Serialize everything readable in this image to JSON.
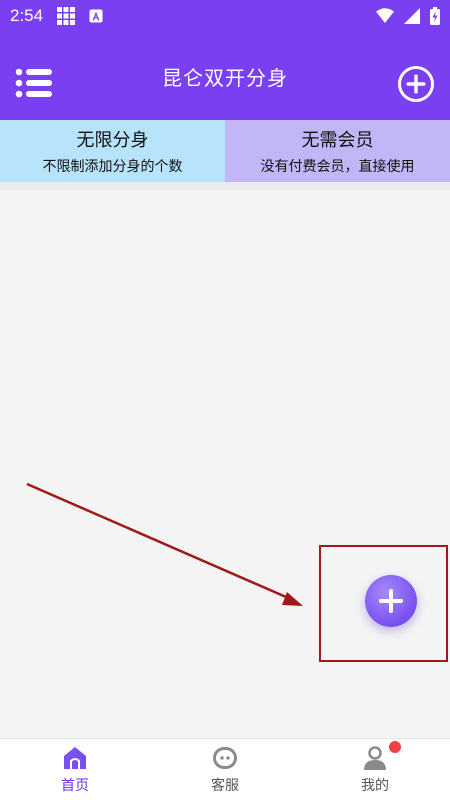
{
  "status_bar": {
    "time": "2:54",
    "icons": [
      "grid-icon",
      "a-badge-icon",
      "wifi-icon",
      "signal-icon",
      "battery-charging-icon"
    ]
  },
  "app_bar": {
    "title": "昆仑双开分身",
    "menu_icon": "list-menu-icon",
    "add_icon": "add-circle-icon"
  },
  "features": [
    {
      "title": "无限分身",
      "subtitle": "不限制添加分身的个数",
      "bg": "#b7e3fb"
    },
    {
      "title": "无需会员",
      "subtitle": "没有付费会员，直接使用",
      "bg": "#c2b6f6"
    }
  ],
  "fab": {
    "icon": "plus-icon",
    "color": "#7a4ff0"
  },
  "annotation": {
    "color": "#a01818"
  },
  "bottom_nav": {
    "items": [
      {
        "label": "首页",
        "icon": "home-icon",
        "active": true
      },
      {
        "label": "客服",
        "icon": "customer-service-icon",
        "active": false
      },
      {
        "label": "我的",
        "icon": "user-icon",
        "active": false,
        "badge": true
      }
    ]
  },
  "colors": {
    "primary": "#7a3ff0",
    "accent": "#6d33e6",
    "badge_red": "#f04040"
  }
}
